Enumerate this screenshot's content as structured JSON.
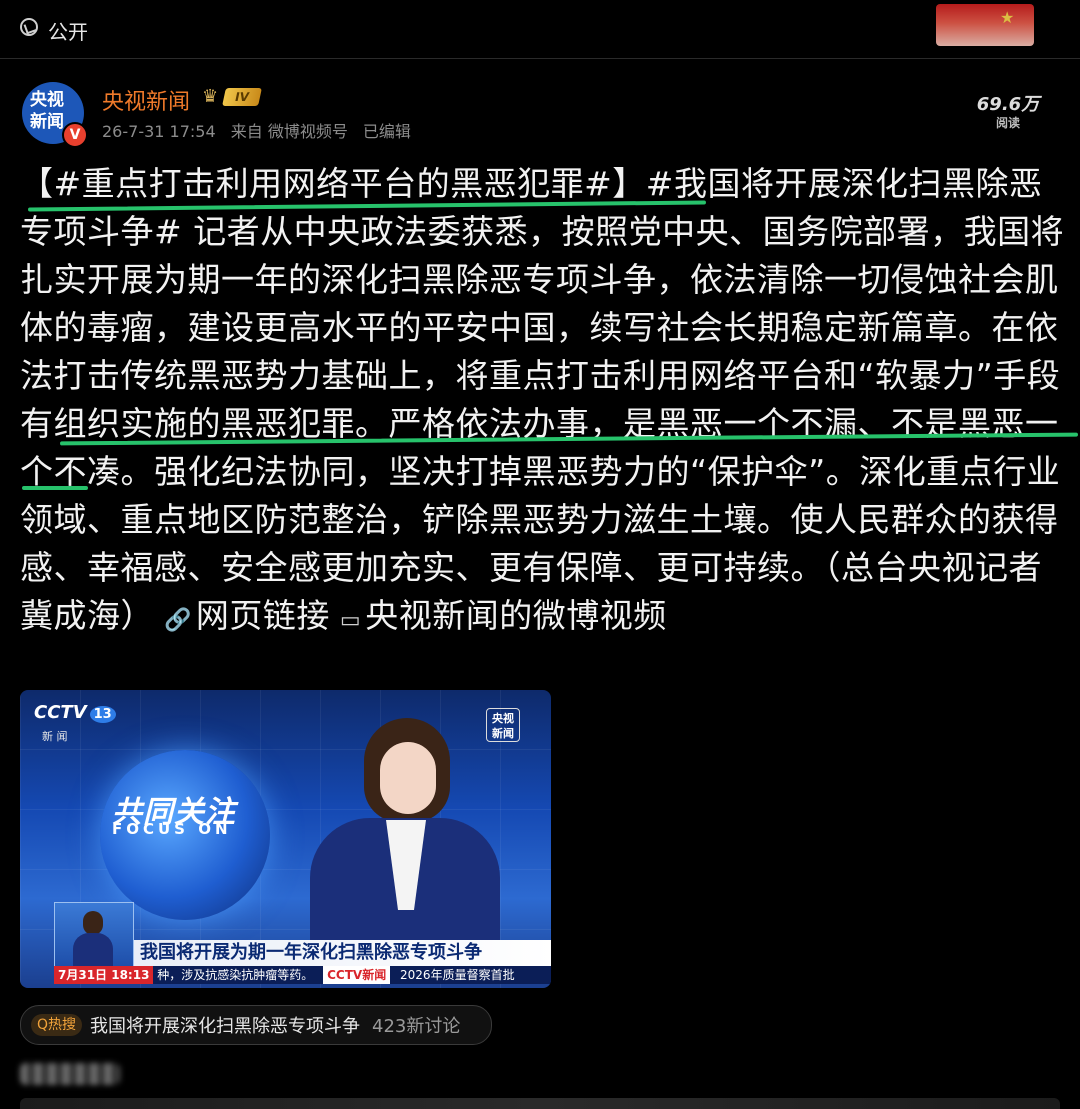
{
  "topbar": {
    "visibility_label": "公开",
    "visibility_icon": "public-globe-icon"
  },
  "author": {
    "avatar_line1": "央视",
    "avatar_line2": "新闻",
    "verified_mark": "V",
    "name": "央视新闻",
    "level_badge": "IV",
    "date": "26-7-31 17:54",
    "source": "来自 微博视频号",
    "edited": "已编辑",
    "reads_count": "69.6万",
    "reads_label": "阅读"
  },
  "post": {
    "segments": [
      "【#重点打击利用网络平台的黑恶犯罪#】#我国将开展深化扫黑除恶专项斗争# 记者从中央政法委获悉，按照党中央、国务院部署，我国将扎实开展为期一年的深化扫黑除恶专项斗争，依法清除一切侵蚀社会肌体的毒瘤，建设更高水平的平安中国，续写社会长期稳定新篇章。在依法打击传统黑恶势力基础上，将重点打击利用网络平台和“软暴力”手段有组织实施的黑恶犯罪。严格依法办事，是黑恶一个不漏、不是黑恶一个不凑。强化纪法协同，坚决打掉黑恶势力的“保护伞”。深化重点行业领域、重点地区防范整治，铲除黑恶势力滋生土壤。使人民群众的获得感、幸福感、安全感更加充实、更有保障、更可持续。（总台央视记者 冀成海）"
    ],
    "link_label": "网页链接",
    "video_link_label": "央视新闻的微博视频"
  },
  "video": {
    "channel_logo": "CCTV",
    "channel_num": "13",
    "channel_sub": "新 闻",
    "program_cn": "共同关注",
    "program_en": "FOCUS ON",
    "corner_logo_line1": "央视",
    "corner_logo_line2": "新闻",
    "headline": "我国将开展为期一年深化扫黑除恶专项斗争",
    "ticker_time": "7月31日 18:13",
    "ticker_text": "种，涉及抗感染抗肿瘤等药。",
    "ticker_brand": "CCTV新闻",
    "ticker_text2": "2026年质量督察首批"
  },
  "hot_search": {
    "tag": "Q热搜",
    "title": "我国将开展深化扫黑除恶专项斗争",
    "count": "423新讨论"
  },
  "colors": {
    "background": "#000000",
    "author_name": "#f07a2a",
    "highlight_underline": "#27c26b",
    "meta_text": "#8c8c8c"
  }
}
